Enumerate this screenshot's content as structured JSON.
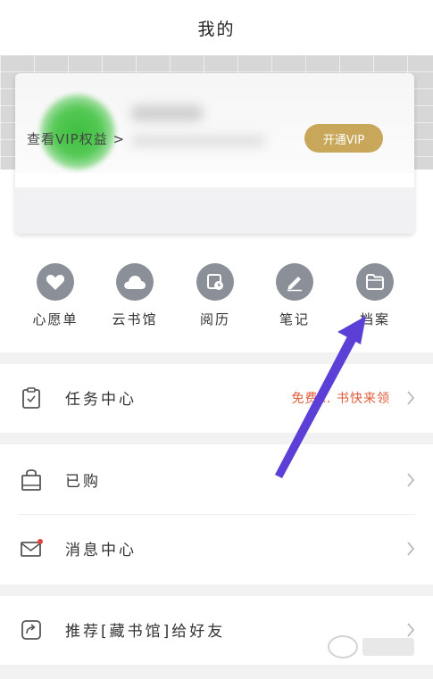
{
  "header": {
    "title": "我的"
  },
  "profile_card": {
    "vip_rights_label": "查看VIP权益 >",
    "open_vip_label": "开通VIP"
  },
  "shortcuts": [
    {
      "label": "心愿单",
      "icon": "heart-icon"
    },
    {
      "label": "云书馆",
      "icon": "cloud-icon"
    },
    {
      "label": "阅历",
      "icon": "calendar-icon"
    },
    {
      "label": "笔记",
      "icon": "pen-icon"
    },
    {
      "label": "档案",
      "icon": "folder-icon"
    }
  ],
  "menu": {
    "task_center": {
      "label": "任务中心",
      "hint": "免费… 书快来领",
      "icon": "clipboard-icon"
    },
    "purchased": {
      "label": "已购",
      "icon": "shopping-bag-icon"
    },
    "messages": {
      "label": "消息中心",
      "icon": "mail-icon",
      "has_badge": true
    },
    "recommend": {
      "label": "推荐[藏书馆]给好友",
      "icon": "share-icon"
    }
  },
  "colors": {
    "accent_gold": "#c9a75a",
    "icon_gray": "#8a8f98",
    "hint_red": "#e05a3a",
    "arrow_purple": "#5b3fd6"
  }
}
